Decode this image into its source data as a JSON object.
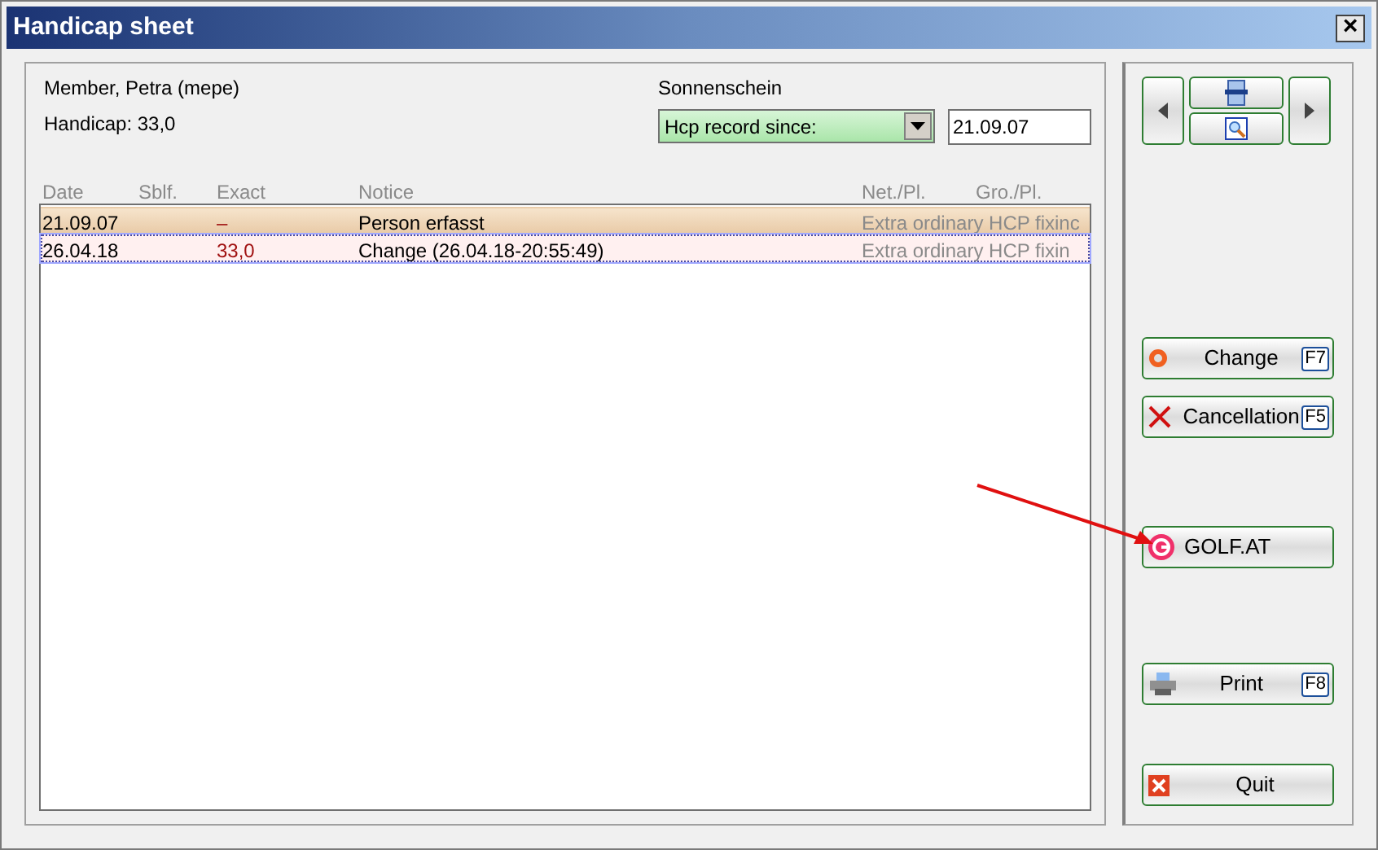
{
  "window": {
    "title": "Handicap sheet",
    "close": "×"
  },
  "member": {
    "name": "Member, Petra (mepe)",
    "handicap": "Handicap: 33,0"
  },
  "filter": {
    "club": "Sonnenschein",
    "mode": "Hcp record since:",
    "date": "21.09.07"
  },
  "table": {
    "columns": [
      "Date",
      "Sblf.",
      "Exact",
      "Notice",
      "Net./Pl.",
      "Gro./Pl."
    ],
    "rows": [
      {
        "date": "21.09.07",
        "exact": "–",
        "notice": "Person erfasst",
        "net": "Extra ordinary HCP fixinc",
        "selected": false
      },
      {
        "date": "26.04.18",
        "exact": "33,0",
        "notice": "Change (26.04.18-20:55:49)",
        "net": "Extra ordinary HCP fixin",
        "selected": true
      }
    ]
  },
  "actions": [
    {
      "kind": "change",
      "label": "Change",
      "key": "F7"
    },
    {
      "kind": "cancel",
      "label": "Cancellation",
      "key": "F5"
    },
    {
      "kind": "golf",
      "label": "GOLF.AT"
    },
    {
      "kind": "print",
      "label": "Print",
      "key": "F8"
    },
    {
      "kind": "quit",
      "label": "Quit"
    }
  ]
}
